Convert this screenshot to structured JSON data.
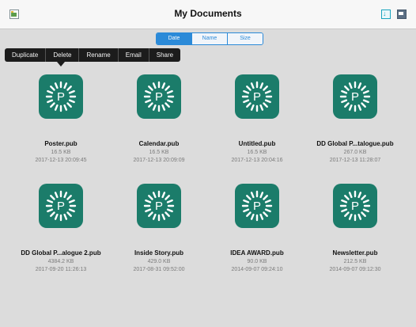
{
  "header": {
    "title": "My Documents",
    "left_icon": "image-icon",
    "right_icons": [
      "import-icon",
      "mail-icon"
    ]
  },
  "sort": {
    "options": [
      "Date",
      "Name",
      "Size"
    ],
    "selected": "Date"
  },
  "context_menu": {
    "items": [
      "Duplicate",
      "Delete",
      "Rename",
      "Email",
      "Share"
    ]
  },
  "colors": {
    "accent": "#2b8ad8",
    "app_icon": "#1b7c6a",
    "menu_bg": "#1c1c1c"
  },
  "files": [
    {
      "name": "Poster.pub",
      "size": "16.5 KB",
      "date": "2017-12-13 20:09:45"
    },
    {
      "name": "Calendar.pub",
      "size": "16.5 KB",
      "date": "2017-12-13 20:09:09"
    },
    {
      "name": "Untitled.pub",
      "size": "16.5 KB",
      "date": "2017-12-13 20:04:16"
    },
    {
      "name": "DD Global P...talogue.pub",
      "size": "267.0 KB",
      "date": "2017-12-13 11:28:07"
    },
    {
      "name": "DD Global P...alogue 2.pub",
      "size": "4384.2 KB",
      "date": "2017-09-20 11:26:13"
    },
    {
      "name": "Inside Story.pub",
      "size": "429.0 KB",
      "date": "2017-08-31 09:52:00"
    },
    {
      "name": "IDEA AWARD.pub",
      "size": "90.0 KB",
      "date": "2014-09-07 09:24:10"
    },
    {
      "name": "Newsletter.pub",
      "size": "212.5 KB",
      "date": "2014-09-07 09:12:30"
    }
  ]
}
